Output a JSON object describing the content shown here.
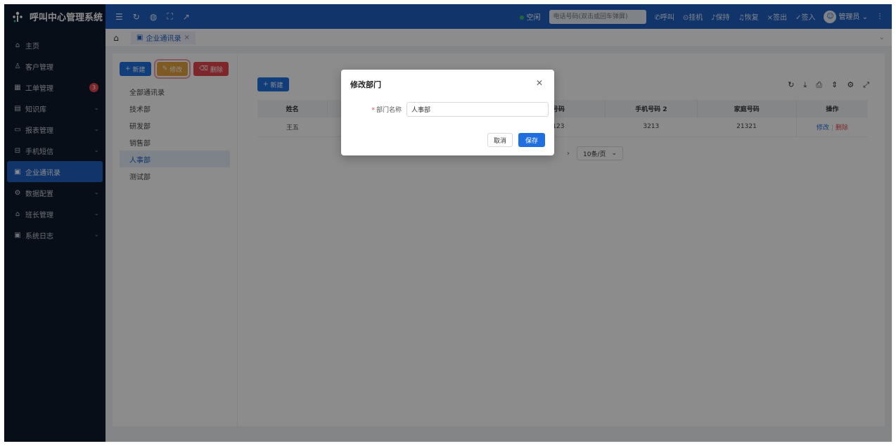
{
  "app": {
    "title": "呼叫中心管理系统"
  },
  "header": {
    "status": "空闲",
    "phone_placeholder": "电话号码(双击或回车弹屏)",
    "actions": [
      "呼叫",
      "挂机",
      "保持",
      "恢复",
      "签出",
      "签入"
    ],
    "user": "管理员"
  },
  "sidebar": {
    "items": [
      {
        "label": "主页",
        "icon": "home-icon",
        "glyph": "⌂"
      },
      {
        "label": "客户管理",
        "icon": "user-icon",
        "glyph": "♙"
      },
      {
        "label": "工单管理",
        "icon": "grid-icon",
        "glyph": "▦",
        "badge": "3"
      },
      {
        "label": "知识库",
        "icon": "book-icon",
        "glyph": "▤",
        "has_children": true
      },
      {
        "label": "报表管理",
        "icon": "monitor-icon",
        "glyph": "▭",
        "has_children": true
      },
      {
        "label": "手机短信",
        "icon": "message-icon",
        "glyph": "⊟",
        "has_children": true
      },
      {
        "label": "企业通讯录",
        "icon": "contacts-icon",
        "glyph": "▣",
        "active": true
      },
      {
        "label": "数据配置",
        "icon": "settings-icon",
        "glyph": "⚙",
        "has_children": true
      },
      {
        "label": "班长管理",
        "icon": "home-icon",
        "glyph": "⌂",
        "has_children": true
      },
      {
        "label": "系统日志",
        "icon": "log-icon",
        "glyph": "▣",
        "has_children": true
      }
    ]
  },
  "tabs": {
    "active_tab": "企业通讯录"
  },
  "dept_pane": {
    "new_label": "新建",
    "edit_label": "修改",
    "delete_label": "删除",
    "departments": [
      "全部通讯录",
      "技术部",
      "研发部",
      "销售部",
      "人事部",
      "测试部"
    ],
    "selected_index": 4
  },
  "table": {
    "new_label": "新建",
    "columns": [
      "姓名",
      "",
      "",
      "号码",
      "手机号码 2",
      "家庭号码",
      "操作"
    ],
    "rows": [
      {
        "name": "王五",
        "c2": "",
        "c3": "",
        "phone": "123",
        "phone2": "3213",
        "home": "21321",
        "edit": "修改",
        "delete": "删除"
      }
    ],
    "page_size": "10条/页"
  },
  "modal": {
    "title": "修改部门",
    "field_label": "部门名称",
    "field_value": "人事部",
    "cancel_label": "取消",
    "save_label": "保存"
  },
  "colors": {
    "primary": "#1f6fe0",
    "sidebar": "#0f1a2b",
    "danger": "#e5484d",
    "warning": "#e6a23c"
  }
}
